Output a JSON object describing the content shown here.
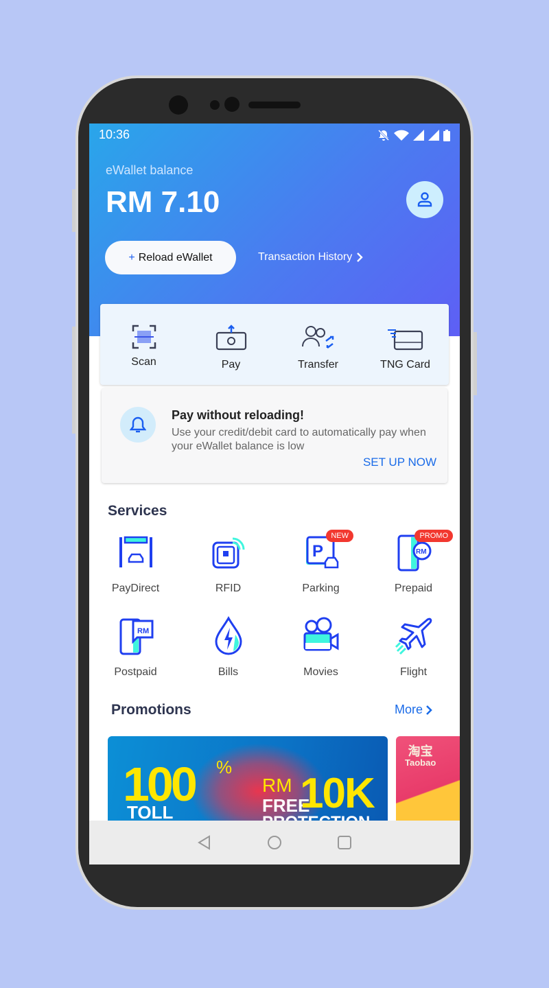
{
  "status_bar": {
    "time": "10:36",
    "icons": [
      "bell-off-icon",
      "wifi-icon",
      "signal-icon",
      "signal-icon",
      "battery-icon"
    ]
  },
  "header": {
    "balance_label": "eWallet balance",
    "balance": "RM 7.10",
    "reload_label": "Reload eWallet",
    "history_label": "Transaction History"
  },
  "quick_actions": [
    {
      "label": "Scan",
      "icon": "scan-icon"
    },
    {
      "label": "Pay",
      "icon": "pay-icon"
    },
    {
      "label": "Transfer",
      "icon": "transfer-icon"
    },
    {
      "label": "TNG Card",
      "icon": "card-icon"
    }
  ],
  "notice": {
    "title": "Pay without reloading!",
    "text": "Use your credit/debit card to automatically pay when your eWallet balance is low",
    "cta": "SET UP NOW"
  },
  "services": {
    "title": "Services",
    "items": [
      {
        "label": "PayDirect",
        "icon": "toll-gate-icon"
      },
      {
        "label": "RFID",
        "icon": "rfid-icon"
      },
      {
        "label": "Parking",
        "icon": "parking-icon",
        "badge": "NEW"
      },
      {
        "label": "Prepaid",
        "icon": "prepaid-phone-icon",
        "badge": "PROMO"
      },
      {
        "label": "Postpaid",
        "icon": "postpaid-phone-icon"
      },
      {
        "label": "Bills",
        "icon": "bills-icon"
      },
      {
        "label": "Movies",
        "icon": "movie-camera-icon"
      },
      {
        "label": "Flight",
        "icon": "plane-icon"
      }
    ]
  },
  "promotions": {
    "title": "Promotions",
    "more_label": "More",
    "banner1": {
      "big": "100",
      "pct": "%",
      "toll": "TOLL",
      "rm": "RM",
      "free": "FREE",
      "amount": "10K",
      "protection": "PROTECTION"
    },
    "banner2": {
      "brand_cn": "淘宝",
      "brand": "Taobao"
    }
  },
  "colors": {
    "accent": "#1a6be8",
    "badge": "#f2382f",
    "icon_blue": "#1f3ff0",
    "icon_teal": "#3ff5de"
  }
}
